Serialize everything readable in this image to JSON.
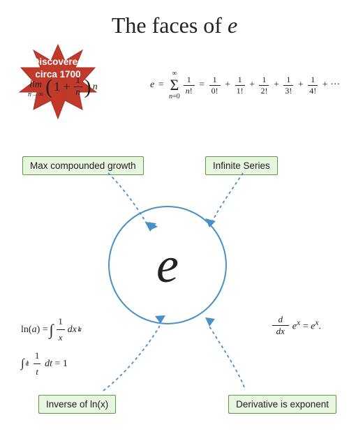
{
  "title": {
    "text_before": "The faces of ",
    "italic": "e"
  },
  "badge": {
    "line1": "Discovered",
    "line2": "circa  1700"
  },
  "labels": {
    "max_growth": "Max compounded growth",
    "infinite_series": "Infinite Series",
    "inverse_ln": "Inverse of ln(x)",
    "derivative": "Derivative is exponent"
  },
  "center": {
    "letter": "e"
  }
}
